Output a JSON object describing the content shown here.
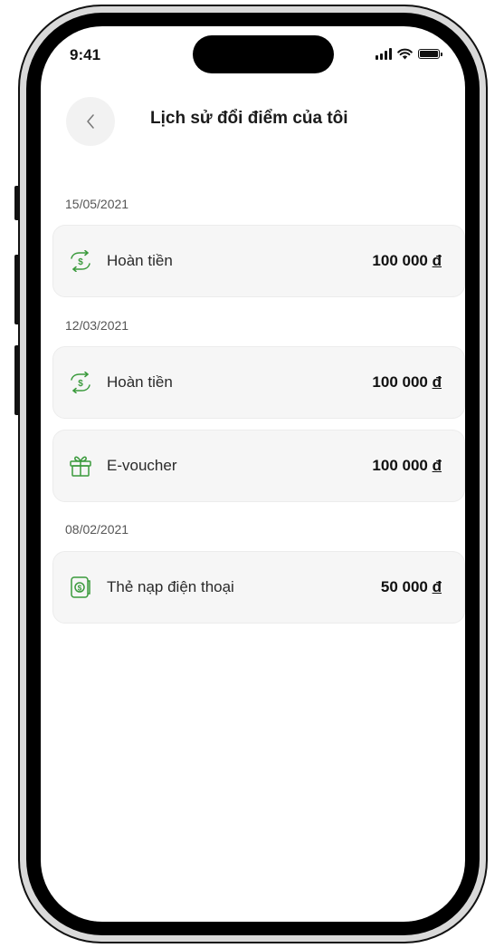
{
  "status_bar": {
    "time": "9:41"
  },
  "header": {
    "title": "Lịch sử đổi điểm của tôi"
  },
  "colors": {
    "accent": "#3a9a3c",
    "card_bg": "#f6f6f6"
  },
  "groups": [
    {
      "date": "15/05/2021",
      "items": [
        {
          "icon": "refund-exchange-icon",
          "label": "Hoàn tiền",
          "amount": "100 000",
          "currency": "đ"
        }
      ]
    },
    {
      "date": "12/03/2021",
      "items": [
        {
          "icon": "refund-exchange-icon",
          "label": "Hoàn tiền",
          "amount": "100 000",
          "currency": "đ"
        },
        {
          "icon": "gift-icon",
          "label": "E-voucher",
          "amount": "100 000",
          "currency": "đ"
        }
      ]
    },
    {
      "date": "08/02/2021",
      "items": [
        {
          "icon": "phone-card-icon",
          "label": "Thẻ nạp điện thoại",
          "amount": "50 000",
          "currency": "đ"
        }
      ]
    }
  ]
}
